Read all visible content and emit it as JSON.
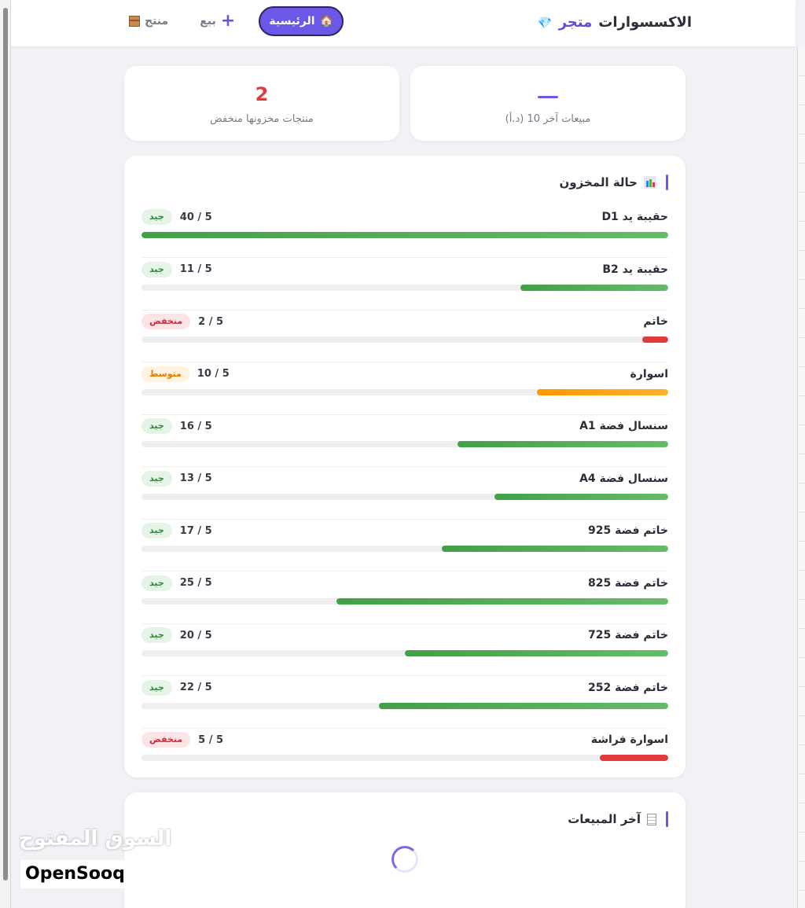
{
  "header": {
    "brand_gem": "💎",
    "brand_part1": "متجر",
    "brand_part2": "الاكسسوارات",
    "nav": [
      {
        "id": "home",
        "icon": "🏠",
        "label": "الرئيسية",
        "active": true
      },
      {
        "id": "sale",
        "icon": "+",
        "label": "بيع",
        "active": false
      },
      {
        "id": "product",
        "icon": "📦",
        "label": "منتج",
        "active": false
      }
    ]
  },
  "stats": {
    "sales": {
      "value": "—",
      "label": "مبيعات آخر 10 (د.أ)"
    },
    "low_stock": {
      "value": "2",
      "label": "منتجات مخزونها منخفض"
    }
  },
  "inventory": {
    "title": "حالة المخزون",
    "title_icon": "bar-chart-icon",
    "items": [
      {
        "name": "حقيبة يد D1",
        "qty": "40 / 5",
        "status": "جيد",
        "level": "good",
        "fill": 1.0
      },
      {
        "name": "حقيبة يد B2",
        "qty": "11 / 5",
        "status": "جيد",
        "level": "good",
        "fill": 0.28
      },
      {
        "name": "خاتم",
        "qty": "2 / 5",
        "status": "منخفض",
        "level": "low",
        "fill": 0.05
      },
      {
        "name": "اسوارة",
        "qty": "10 / 5",
        "status": "متوسط",
        "level": "mid",
        "fill": 0.25
      },
      {
        "name": "سنسال فضة A1",
        "qty": "16 / 5",
        "status": "جيد",
        "level": "good",
        "fill": 0.4
      },
      {
        "name": "سنسال فضة A4",
        "qty": "13 / 5",
        "status": "جيد",
        "level": "good",
        "fill": 0.33
      },
      {
        "name": "خاتم فضة 925",
        "qty": "17 / 5",
        "status": "جيد",
        "level": "good",
        "fill": 0.43
      },
      {
        "name": "خاتم فضة 825",
        "qty": "25 / 5",
        "status": "جيد",
        "level": "good",
        "fill": 0.63
      },
      {
        "name": "خاتم فضة 725",
        "qty": "20 / 5",
        "status": "جيد",
        "level": "good",
        "fill": 0.5
      },
      {
        "name": "خاتم فضة 252",
        "qty": "22 / 5",
        "status": "جيد",
        "level": "good",
        "fill": 0.55
      },
      {
        "name": "اسوارة فراشة",
        "qty": "5 / 5",
        "status": "منخفض",
        "level": "low",
        "fill": 0.13
      }
    ]
  },
  "recent_sales": {
    "title": "آخر المبيعات",
    "title_icon": "receipt-icon"
  },
  "watermark": {
    "arabic": "السوق المفتوح",
    "english": "OpenSooq"
  },
  "colors": {
    "accent": "#6b58e6",
    "good": "#4caf50",
    "low": "#e2393b",
    "mid": "#ff9800"
  }
}
